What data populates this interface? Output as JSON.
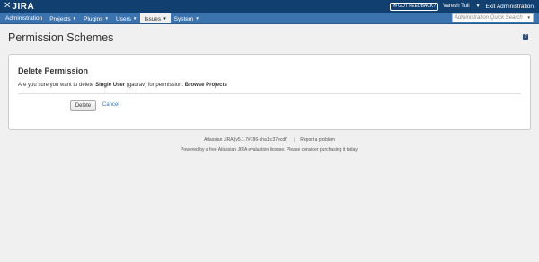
{
  "header": {
    "logo_text": "JIRA",
    "feedback_label": "GOT FEEDBACK?",
    "user_name": "Varesh Tuli",
    "exit_label": "Exit Administration"
  },
  "nav": {
    "items": [
      {
        "label": "Administration",
        "has_caret": false
      },
      {
        "label": "Projects",
        "has_caret": true
      },
      {
        "label": "Plugins",
        "has_caret": true
      },
      {
        "label": "Users",
        "has_caret": true
      },
      {
        "label": "Issues",
        "has_caret": true
      },
      {
        "label": "System",
        "has_caret": true
      }
    ],
    "active": "Issues",
    "search_placeholder": "Administration Quick Search"
  },
  "page": {
    "title": "Permission Schemes",
    "help_glyph": "?"
  },
  "dialog": {
    "title": "Delete Permission",
    "message_prefix": "Are you sure you want to delete",
    "entity_type": "Single User",
    "entity_value": "(gaurav)",
    "message_middle": "for permission:",
    "permission": "Browse Projects",
    "delete_label": "Delete",
    "cancel_label": "Cancel"
  },
  "footer": {
    "version_text": "Atlassian JIRA (v5.1.7#786-sha1:c37ecdf)",
    "separator": "|",
    "report_label": "Report a problem",
    "license_text": "Powered by a free Atlassian JIRA evaluation license. Please consider purchasing it today."
  },
  "colors": {
    "header_bg": "#114070",
    "nav_bg": "#3b73af",
    "link": "#3b73af"
  }
}
